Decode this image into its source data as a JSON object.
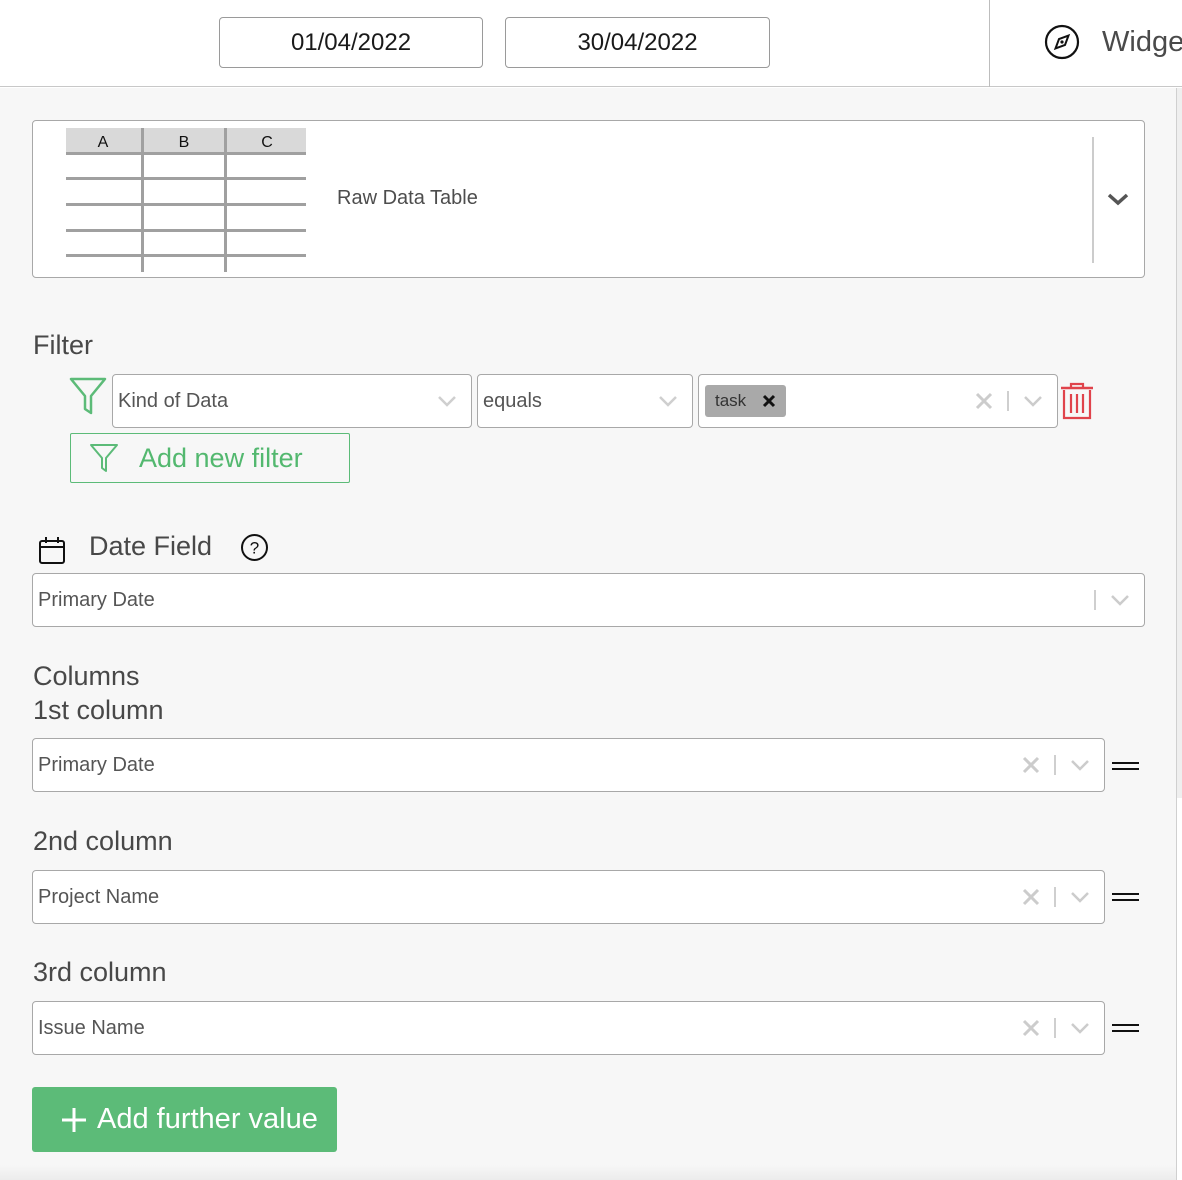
{
  "header": {
    "start_date": "01/04/2022",
    "end_date": "30/04/2022",
    "widget_link_label": "Widge",
    "widget_link_icon": "compass-icon"
  },
  "widget_type": {
    "thumbnail_columns": [
      "A",
      "B",
      "C"
    ],
    "label": "Raw Data Table",
    "icon": "chevron-down-icon"
  },
  "filter": {
    "heading": "Filter",
    "rows": [
      {
        "field": "Kind of Data",
        "operator": "equals",
        "values": [
          "task"
        ]
      }
    ],
    "add_label": "Add new filter"
  },
  "date_field": {
    "heading": "Date Field",
    "value": "Primary Date"
  },
  "columns": {
    "heading": "Columns",
    "items": [
      {
        "label": "1st column",
        "value": "Primary Date"
      },
      {
        "label": "2nd column",
        "value": "Project Name"
      },
      {
        "label": "3rd column",
        "value": "Issue Name"
      }
    ],
    "add_label": "Add further value"
  },
  "colors": {
    "accent_green": "#5cbb78",
    "danger_red": "#e0434b",
    "tag_gray": "#a9a9a9"
  }
}
